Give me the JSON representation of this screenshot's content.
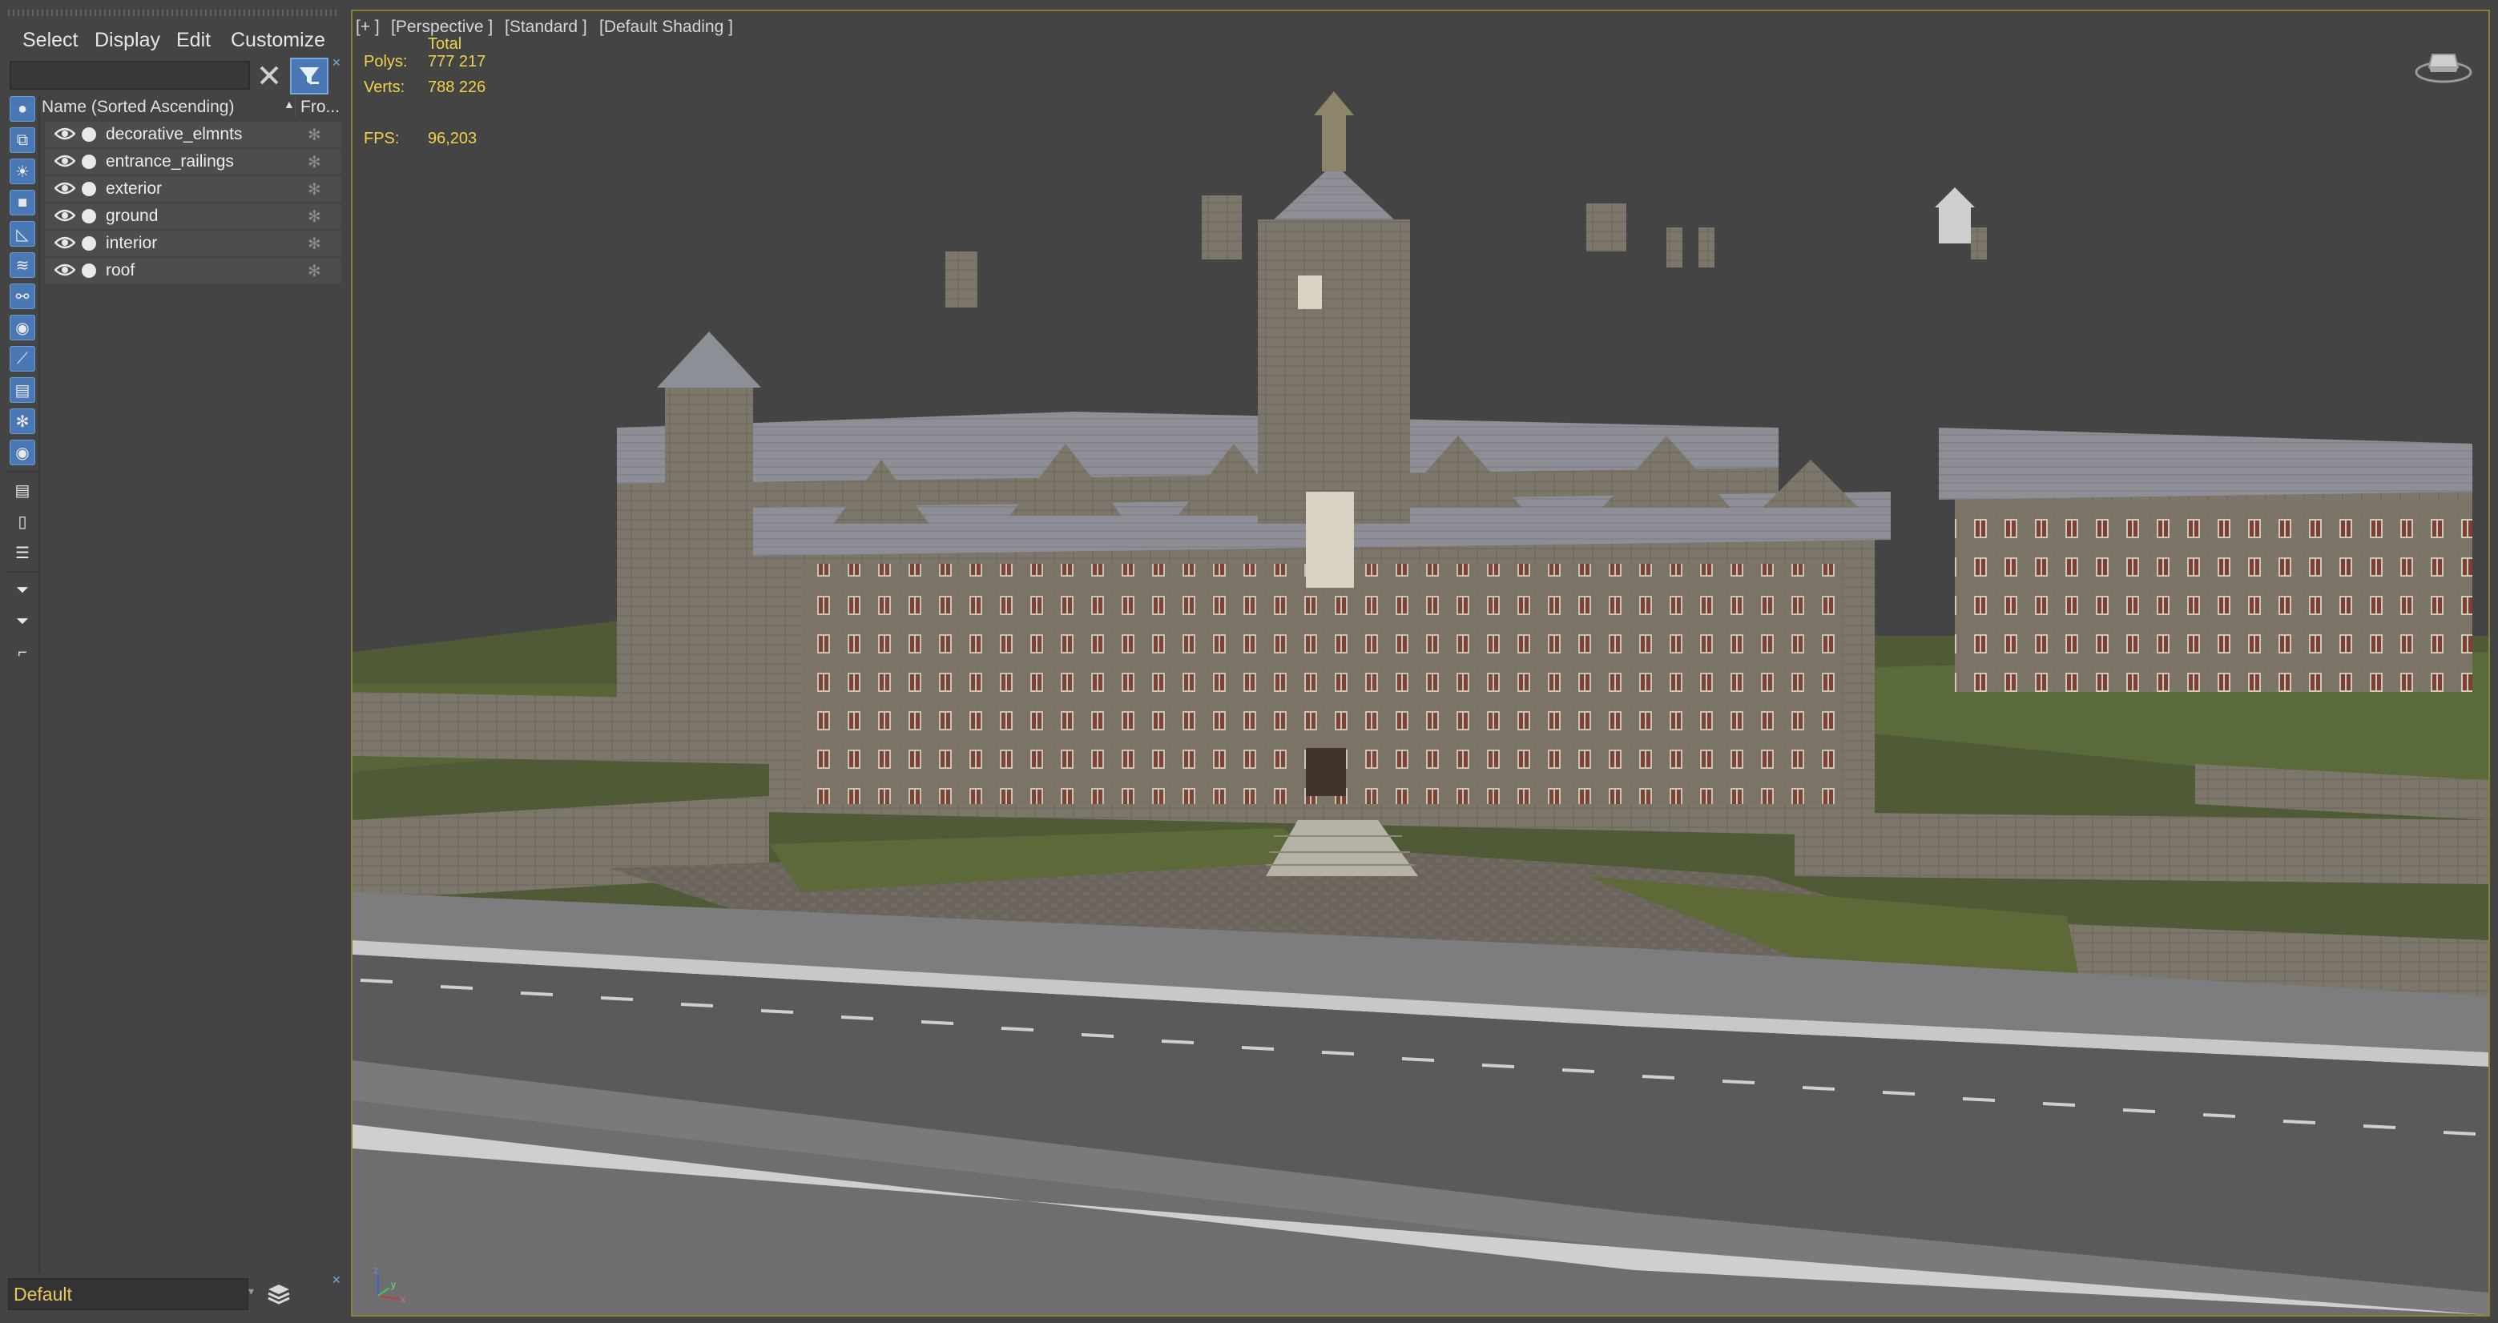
{
  "menu": {
    "select": "Select",
    "display": "Display",
    "edit": "Edit",
    "customize": "Customize"
  },
  "search": {
    "placeholder": ""
  },
  "columns": {
    "name": "Name (Sorted Ascending)",
    "frozen": "Fro..."
  },
  "layers": [
    {
      "label": "decorative_elmnts"
    },
    {
      "label": "entrance_railings"
    },
    {
      "label": "exterior"
    },
    {
      "label": "ground"
    },
    {
      "label": "interior"
    },
    {
      "label": "roof"
    }
  ],
  "layer_bar": {
    "current": "Default"
  },
  "viewport": {
    "plus": "[+ ]",
    "view": "[Perspective ]",
    "camera": "[Standard ]",
    "shading": "[Default Shading ]"
  },
  "stats": {
    "total_label": "Total",
    "polys_label": "Polys:",
    "polys_value": "777 217",
    "verts_label": "Verts:",
    "verts_value": "788 226",
    "fps_label": "FPS:",
    "fps_value": "96,203"
  },
  "axis": {
    "x": "x",
    "y": "y",
    "z": "z"
  },
  "colors": {
    "accent_blue": "#4a78b4",
    "stats_yellow": "#f1d24a",
    "viewport_border": "#8c7f3a",
    "panel_bg": "#444444"
  }
}
